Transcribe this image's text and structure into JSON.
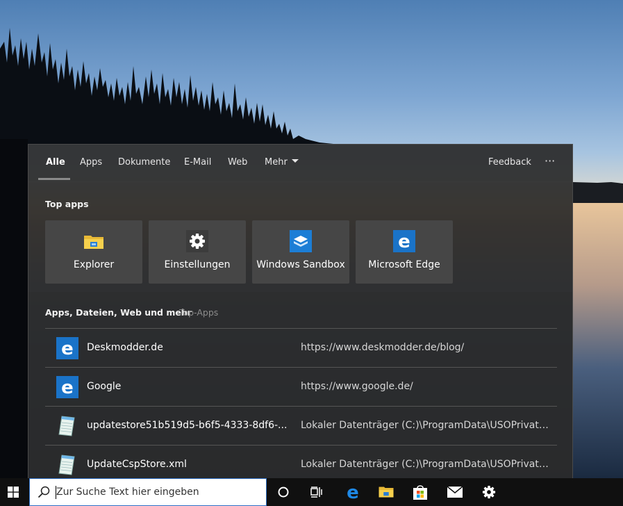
{
  "tabs": {
    "all": "Alle",
    "apps": "Apps",
    "documents": "Dokumente",
    "email": "E-Mail",
    "web": "Web",
    "more": "Mehr",
    "feedback": "Feedback",
    "overflow": "···"
  },
  "top_apps": {
    "title": "Top apps",
    "items": [
      {
        "label": "Explorer",
        "icon": "file-explorer-icon"
      },
      {
        "label": "Einstellungen",
        "icon": "settings-gear-icon"
      },
      {
        "label": "Windows Sandbox",
        "icon": "windows-sandbox-icon"
      },
      {
        "label": "Microsoft Edge",
        "icon": "edge-icon"
      }
    ]
  },
  "results": {
    "title": "Apps, Dateien, Web und mehr",
    "subtitle": "Top-Apps",
    "rows": [
      {
        "name": "Deskmodder.de",
        "path": "https://www.deskmodder.de/blog/",
        "icon": "edge-icon"
      },
      {
        "name": "Google",
        "path": "https://www.google.de/",
        "icon": "edge-icon"
      },
      {
        "name": "updatestore51b519d5-b6f5-4333-8df6-...",
        "path": "Lokaler Datenträger (C:)\\ProgramData\\USOPrivate\\...",
        "icon": "notepad-file-icon"
      },
      {
        "name": "UpdateCspStore.xml",
        "path": "Lokaler Datenträger (C:)\\ProgramData\\USOPrivate\\...",
        "icon": "notepad-file-icon"
      }
    ]
  },
  "taskbar": {
    "search_placeholder": "Zur Suche Text hier eingeben",
    "icons": [
      "windows-start-icon",
      "search-icon",
      "cortana-icon",
      "task-view-icon",
      "edge-icon",
      "file-explorer-icon",
      "store-icon",
      "mail-icon",
      "settings-icon"
    ]
  },
  "colors": {
    "flyout_bg": "#2b2b2b",
    "tile_bg": "#464646",
    "edge_blue": "#1a73c8",
    "taskbar_bg": "#101010"
  }
}
